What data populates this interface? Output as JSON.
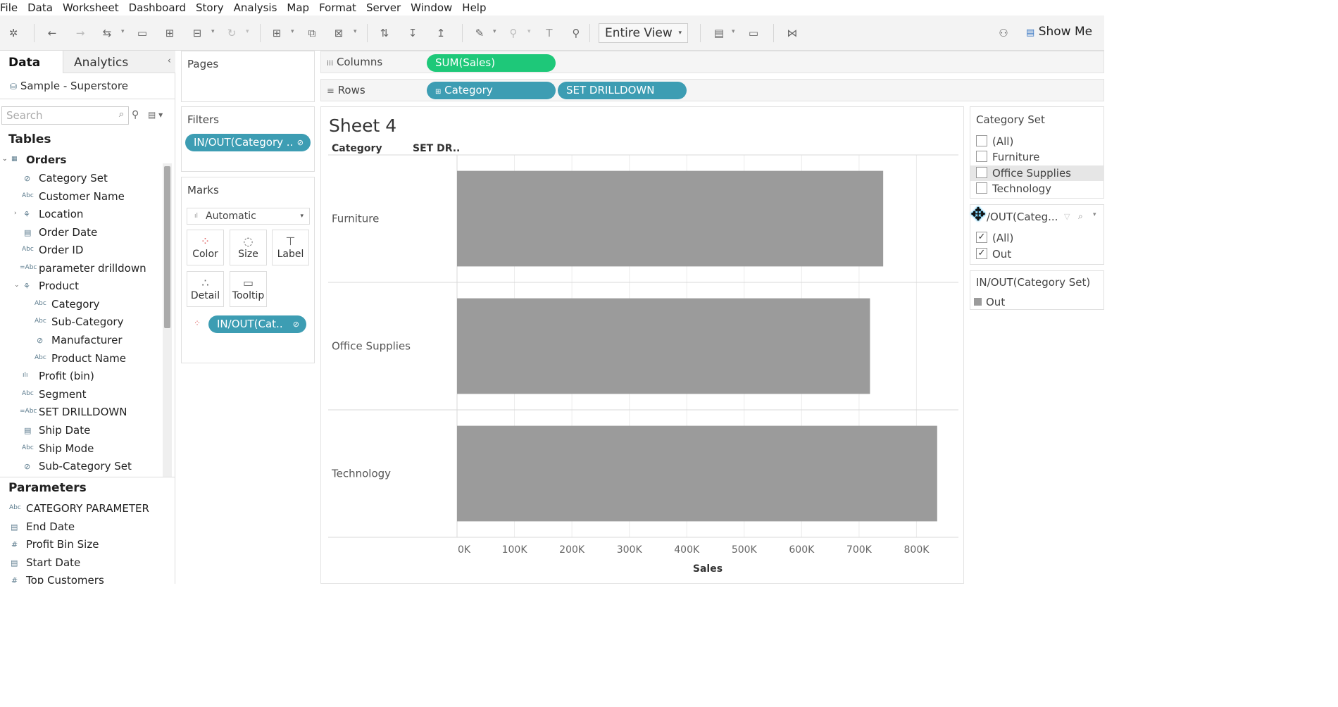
{
  "menu": [
    "File",
    "Data",
    "Worksheet",
    "Dashboard",
    "Story",
    "Analysis",
    "Map",
    "Format",
    "Server",
    "Window",
    "Help"
  ],
  "toolbar": {
    "view_mode": "Entire View",
    "show_me": "Show Me"
  },
  "data_pane": {
    "tab_data": "Data",
    "tab_analytics": "Analytics",
    "datasource": "Sample - Superstore",
    "search_placeholder": "Search",
    "tables_title": "Tables",
    "table_name": "Orders",
    "fields": [
      "Category Set",
      "Customer Name",
      "Location",
      "Order Date",
      "Order ID",
      "parameter drilldown",
      "Product",
      "Category",
      "Sub-Category",
      "Manufacturer",
      "Product Name",
      "Profit (bin)",
      "Segment",
      "SET DRILLDOWN",
      "Ship Date",
      "Ship Mode",
      "Sub-Category Set"
    ],
    "parameters_title": "Parameters",
    "parameters": [
      "CATEGORY PARAMETER",
      "End Date",
      "Profit Bin Size",
      "Start Date",
      "Top Customers"
    ]
  },
  "pages": {
    "title": "Pages"
  },
  "filters": {
    "title": "Filters",
    "pill": "IN/OUT(Category .."
  },
  "marks": {
    "title": "Marks",
    "type": "Automatic",
    "buttons": [
      "Color",
      "Size",
      "Label",
      "Detail",
      "Tooltip"
    ],
    "pill": "IN/OUT(Cat.."
  },
  "shelves": {
    "columns_label": "Columns",
    "columns_pill": "SUM(Sales)",
    "rows_label": "Rows",
    "rows_pills": [
      "Category",
      "SET DRILLDOWN"
    ]
  },
  "sheet": {
    "title": "Sheet 4",
    "header_category": "Category",
    "header_set": "SET DR.."
  },
  "chart_data": {
    "type": "bar",
    "orientation": "horizontal",
    "categories": [
      "Furniture",
      "Office Supplies",
      "Technology"
    ],
    "values": [
      742000,
      719000,
      836000
    ],
    "xlabel": "Sales",
    "ticks": [
      "0K",
      "100K",
      "200K",
      "300K",
      "400K",
      "500K",
      "600K",
      "700K",
      "800K"
    ],
    "xlim": [
      0,
      873000
    ],
    "bar_color": "#9b9b9b"
  },
  "category_set": {
    "title": "Category Set",
    "items": [
      {
        "label": "(All)",
        "checked": false
      },
      {
        "label": "Furniture",
        "checked": false
      },
      {
        "label": "Office Supplies",
        "checked": false
      },
      {
        "label": "Technology",
        "checked": false
      }
    ]
  },
  "inout_filter": {
    "title": "/OUT(Categ...",
    "items": [
      {
        "label": "(All)",
        "checked": true
      },
      {
        "label": "Out",
        "checked": true
      }
    ]
  },
  "inout_legend": {
    "title": "IN/OUT(Category Set)",
    "item": "Out"
  }
}
